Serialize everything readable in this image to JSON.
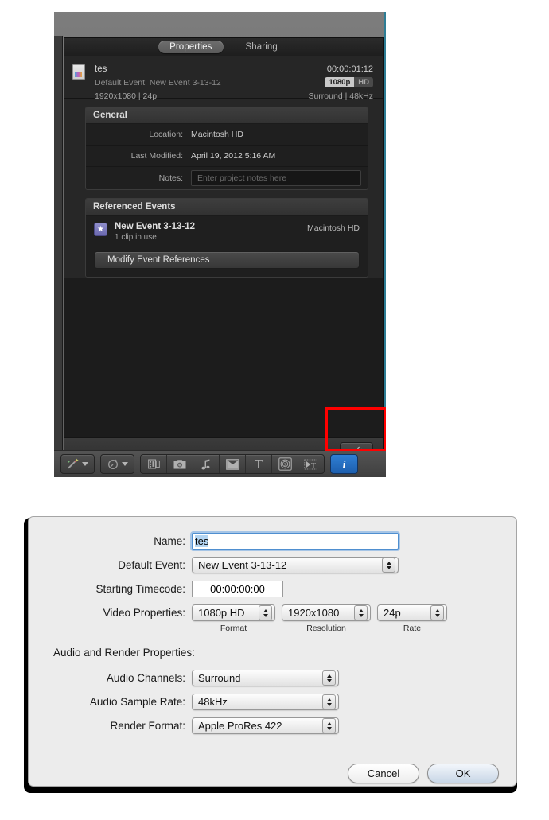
{
  "inspector": {
    "tabs": [
      {
        "label": "Properties",
        "active": true
      },
      {
        "label": "Sharing",
        "active": false
      }
    ],
    "header": {
      "project_name": "tes",
      "timecode": "00:00:01:12",
      "default_event_label": "Default Event:",
      "default_event_value": "New Event 3-13-12",
      "badge_resolution": "1080p",
      "badge_quality": "HD",
      "video_summary": "1920x1080  |  24p",
      "audio_summary": "Surround  |  48kHz"
    },
    "general": {
      "title": "General",
      "rows": [
        {
          "label": "Location:",
          "value": "Macintosh HD"
        },
        {
          "label": "Last Modified:",
          "value": "April 19, 2012 5:16 AM"
        }
      ],
      "notes_label": "Notes:",
      "notes_placeholder": "Enter project notes here",
      "notes_value": ""
    },
    "referenced_events": {
      "title": "Referenced Events",
      "event_name": "New Event 3-13-12",
      "event_clips": "1 clip in use",
      "event_location": "Macintosh HD",
      "modify_button": "Modify Event References"
    },
    "footer": {
      "wrench_icon": "wrench-icon"
    },
    "toolbar": {
      "buttons": [
        {
          "name": "enhancement-tools-button",
          "icon": "magic-wand-icon",
          "has_caret": true
        },
        {
          "name": "retime-button",
          "icon": "retime-speed-icon",
          "has_caret": true
        },
        {
          "name": "transitions-browser-button",
          "icon": "film-strip-icon"
        },
        {
          "name": "photos-browser-button",
          "icon": "camera-icon"
        },
        {
          "name": "music-browser-button",
          "icon": "music-note-icon"
        },
        {
          "name": "titles-browser-button",
          "icon": "envelope-x-icon"
        },
        {
          "name": "text-tool-button",
          "icon": "text-t-icon"
        },
        {
          "name": "generators-browser-button",
          "icon": "target-icon"
        },
        {
          "name": "themes-browser-button",
          "icon": "theme-text-icon"
        },
        {
          "name": "inspector-toggle-button",
          "icon": "info-i-icon"
        }
      ]
    },
    "highlight": {
      "name": "red-highlight-box",
      "color": "#ff0000"
    }
  },
  "sheet": {
    "fields": {
      "name_label": "Name:",
      "name_value": "tes",
      "default_event_label": "Default Event:",
      "default_event_value": "New Event 3-13-12",
      "starting_timecode_label": "Starting Timecode:",
      "starting_timecode_value": "00:00:00:00",
      "video_properties_label": "Video Properties:",
      "format_value": "1080p HD",
      "format_caption": "Format",
      "resolution_value": "1920x1080",
      "resolution_caption": "Resolution",
      "rate_value": "24p",
      "rate_caption": "Rate",
      "audio_render_heading": "Audio and Render Properties:",
      "audio_channels_label": "Audio Channels:",
      "audio_channels_value": "Surround",
      "audio_sample_rate_label": "Audio Sample Rate:",
      "audio_sample_rate_value": "48kHz",
      "render_format_label": "Render Format:",
      "render_format_value": "Apple ProRes 422"
    },
    "buttons": {
      "cancel": "Cancel",
      "ok": "OK"
    }
  }
}
